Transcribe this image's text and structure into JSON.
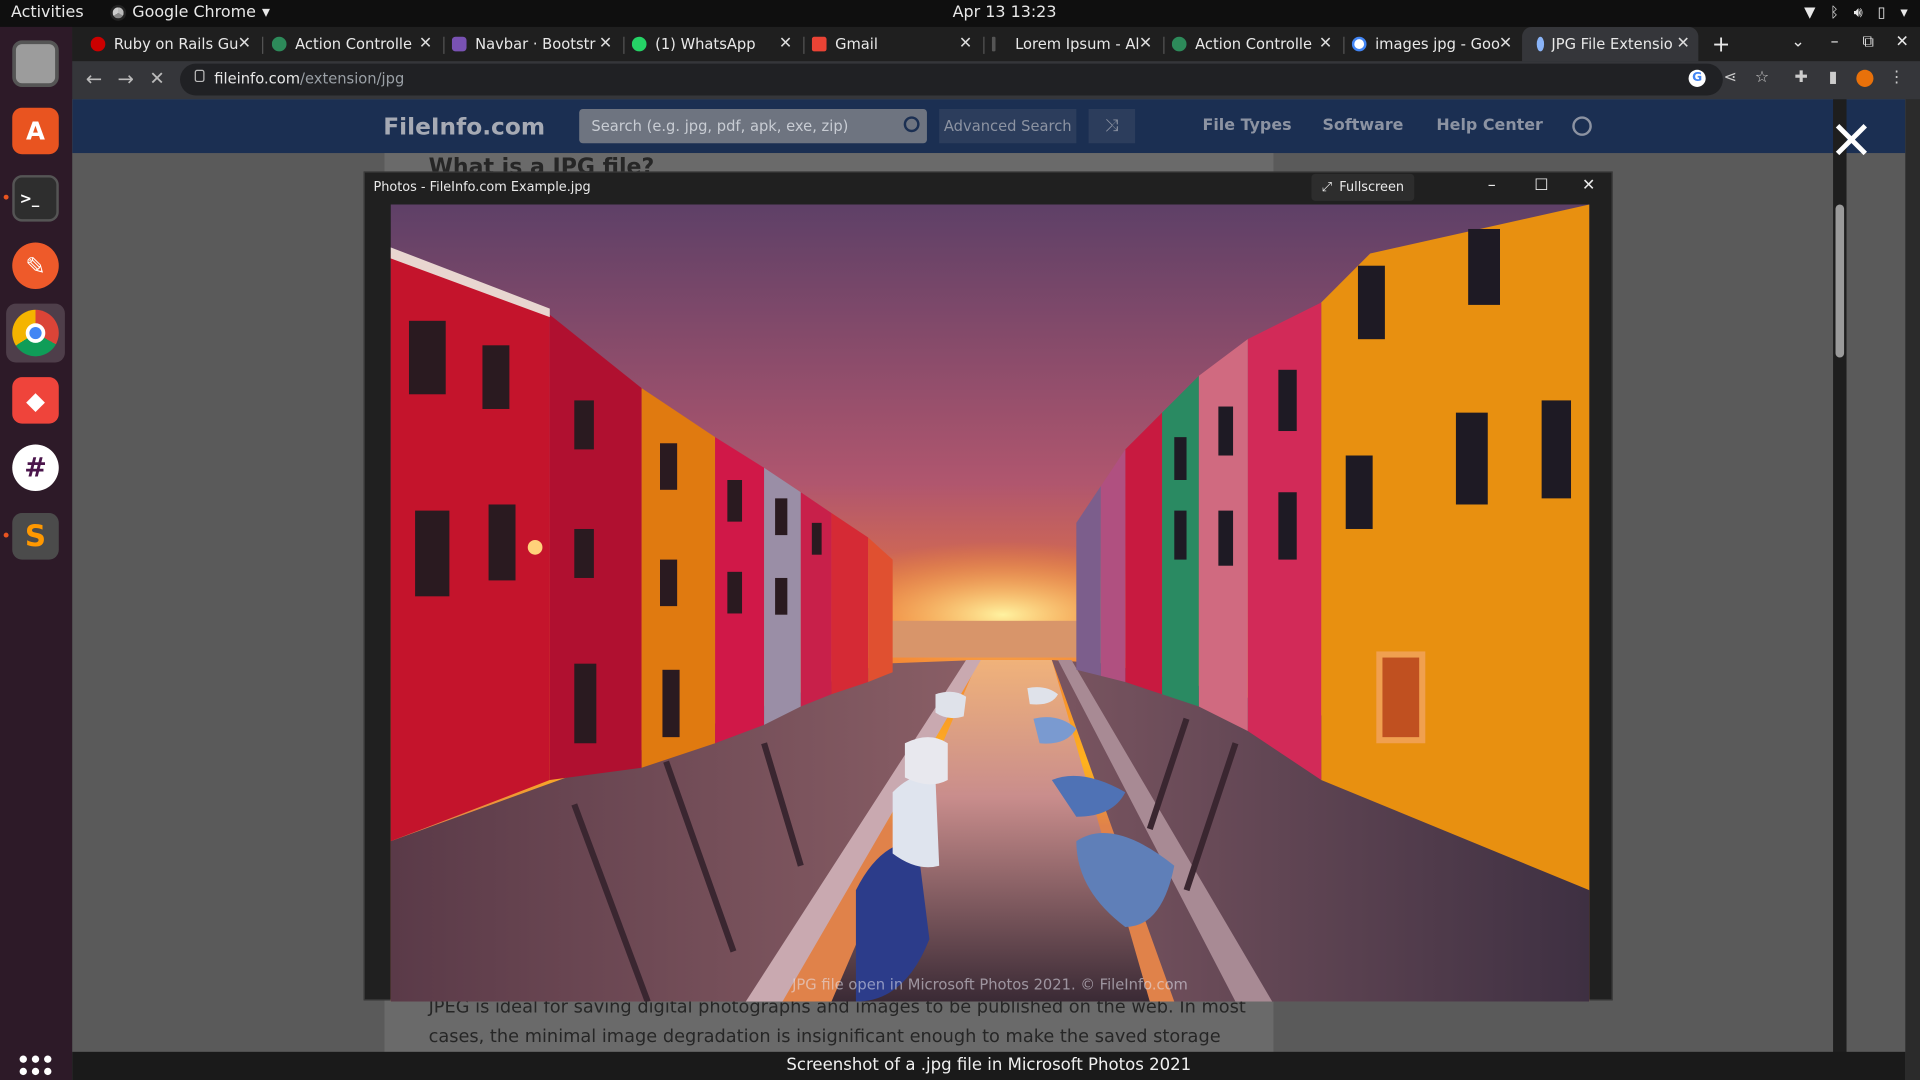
{
  "system": {
    "activities": "Activities",
    "app_name": "Google Chrome",
    "clock": "Apr 13  13:23"
  },
  "dock": {
    "items": [
      "files",
      "software-center",
      "terminal",
      "text-editor",
      "chrome",
      "anydesk",
      "slack",
      "sublime-text"
    ]
  },
  "browser": {
    "tabs": [
      {
        "label": "Ruby on Rails Gu",
        "favicon": "rails"
      },
      {
        "label": "Action Controlle",
        "favicon": "rails-guides"
      },
      {
        "label": "Navbar · Bootstr",
        "favicon": "bootstrap"
      },
      {
        "label": "(1) WhatsApp",
        "favicon": "whatsapp"
      },
      {
        "label": "Gmail",
        "favicon": "gmail"
      },
      {
        "label": "Lorem Ipsum - Al",
        "favicon": "lorem"
      },
      {
        "label": "Action Controlle",
        "favicon": "rails-guides"
      },
      {
        "label": "images jpg - Goo",
        "favicon": "google"
      },
      {
        "label": "JPG File Extensio",
        "favicon": "fileinfo",
        "active": true
      }
    ],
    "url_host": "fileinfo.com",
    "url_path": "/extension/jpg"
  },
  "site": {
    "logo": "FileInfo.com",
    "search_placeholder": "Search (e.g. jpg, pdf, apk, exe, zip)",
    "advanced_search": "Advanced Search",
    "nav": [
      "File Types",
      "Software",
      "Help Center"
    ],
    "heading": "What is a JPG file?",
    "body": "JPEG is ideal for saving digital photographs and images to be published on the web. In most cases, the minimal image degradation is insignificant enough to make the saved storage space worth the compression."
  },
  "photos_window": {
    "title": "Photos - FileInfo.com Example.jpg",
    "fullscreen_label": "Fullscreen",
    "watermark": "JPG file open in Microsoft Photos 2021. © FileInfo.com"
  },
  "caption": "Screenshot of a .jpg file in Microsoft Photos 2021",
  "colors": {
    "site_header": "#1b2f52",
    "sky_top": "#6b4a73",
    "sunset": "#ffb020",
    "house_red": "#c4142c",
    "house_orange": "#e07a10"
  }
}
